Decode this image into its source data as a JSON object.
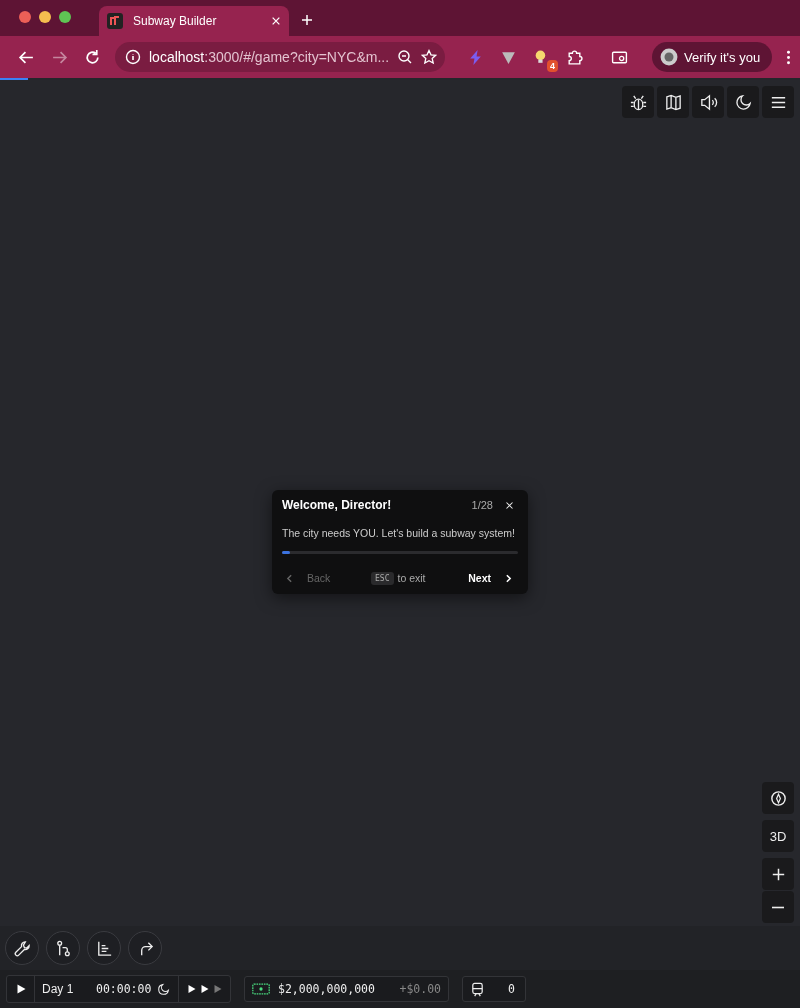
{
  "browser": {
    "tab_title": "Subway Builder",
    "url_host": "localhost",
    "url_rest": ":3000/#/game?city=NYC&m...",
    "extension_badge": "4",
    "profile_button": "Verify it's you"
  },
  "page_loading": {
    "level": 0.035
  },
  "tutorial": {
    "title": "Welcome, Director!",
    "counter": "1/28",
    "body": "The city needs YOU. Let's build a subway system!",
    "level": 0.035,
    "back": {
      "label": "Back",
      "disabled": true
    },
    "esc_key": "ESC",
    "esc_text": "to exit",
    "next": "Next"
  },
  "map_controls": {
    "pitch_button": "3D"
  },
  "status_bar": {
    "day": "Day 1",
    "time": "00:00:00",
    "speeds": [
      {
        "selected": true
      },
      {
        "selected": true
      },
      {
        "selected": false
      }
    ],
    "money": "$2,000,000,000",
    "income": "+$0.00",
    "trains": "0"
  }
}
